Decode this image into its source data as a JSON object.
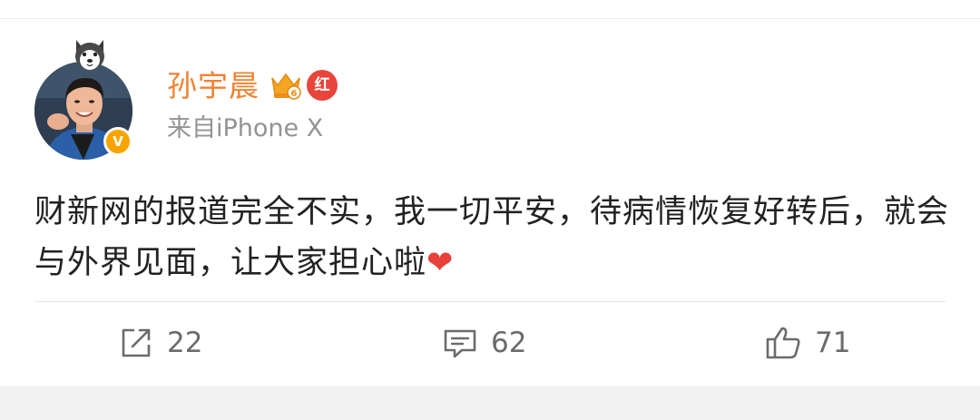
{
  "post": {
    "author": {
      "name": "孙宇晨",
      "verified_letter": "V",
      "badge_label": "红",
      "avatar_icon": "user-photo",
      "colors": {
        "name": "#f28232",
        "verified": "#f7a400",
        "badge": "#e8453c"
      }
    },
    "source": "来自iPhone X",
    "content": {
      "text": "财新网的报道完全不实，我一切平安，待病情恢复好转后，就会与外界见面，让大家担心啦",
      "emoji": "❤"
    },
    "actions": {
      "repost": {
        "icon": "share-icon",
        "count": "22"
      },
      "comment": {
        "icon": "comment-icon",
        "count": "62"
      },
      "like": {
        "icon": "thumbs-up-icon",
        "count": "71"
      }
    }
  }
}
